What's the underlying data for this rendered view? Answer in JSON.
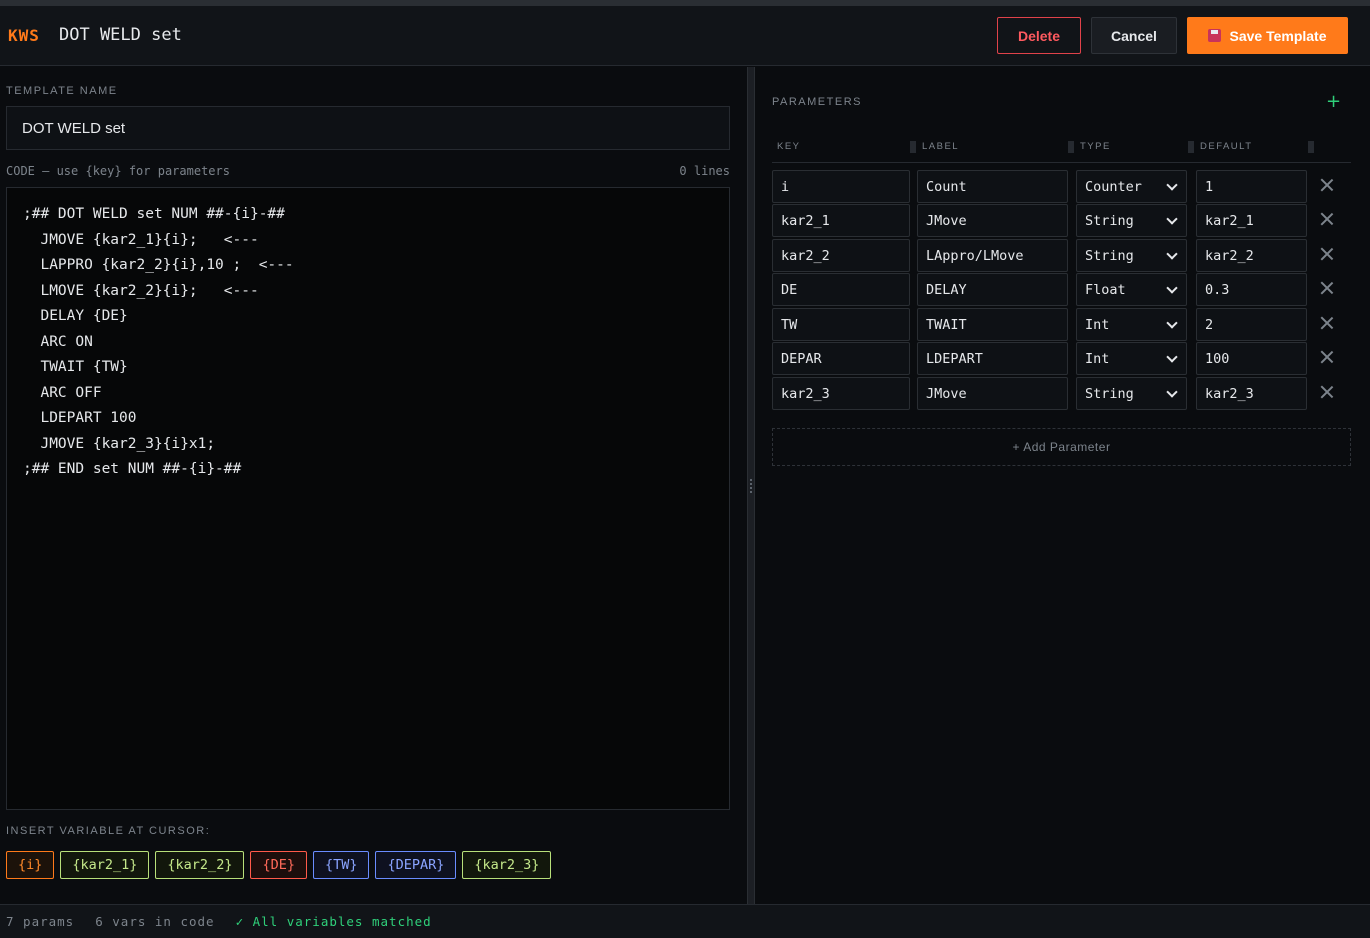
{
  "header": {
    "brand": "KWS",
    "title": "DOT WELD set",
    "delete_label": "Delete",
    "cancel_label": "Cancel",
    "save_label": "Save Template",
    "save_icon": "floppy-disk-icon"
  },
  "editor": {
    "template_name_label": "TEMPLATE NAME",
    "template_name_value": "DOT WELD set",
    "code_label": "CODE — use {key} for parameters",
    "lines_label": "0 lines",
    "code_lines": [
      ";## DOT WELD set NUM ##-{i}-##",
      "  JMOVE {kar2_1}{i};   <---",
      "  LAPPRO {kar2_2}{i},10 ;  <---",
      "  LMOVE {kar2_2}{i};   <---",
      "  DELAY {DE}",
      "  ARC ON",
      "  TWAIT {TW}",
      "  ARC OFF",
      "  LDEPART 100",
      "  JMOVE {kar2_3}{i}x1;",
      ";## END set NUM ##-{i}-##"
    ],
    "insert_label": "INSERT VARIABLE AT CURSOR:",
    "chips": [
      "{i}",
      "{kar2_1}",
      "{kar2_2}",
      "{DE}",
      "{TW}",
      "{DEPAR}",
      "{kar2_3}"
    ]
  },
  "params": {
    "title": "PARAMETERS",
    "add_icon": "plus-icon",
    "columns": [
      "KEY",
      "LABEL",
      "TYPE",
      "DEFAULT"
    ],
    "rows": [
      {
        "key": "i",
        "label": "Count",
        "type": "Counter",
        "default": "1"
      },
      {
        "key": "kar2_1",
        "label": "JMove",
        "type": "String",
        "default": "kar2_1"
      },
      {
        "key": "kar2_2",
        "label": "LAppro/LMove",
        "type": "String",
        "default": "kar2_2"
      },
      {
        "key": "DE",
        "label": "DELAY",
        "type": "Float",
        "default": "0.3"
      },
      {
        "key": "TW",
        "label": "TWAIT",
        "type": "Int",
        "default": "2"
      },
      {
        "key": "DEPAR",
        "label": "LDEPART",
        "type": "Int",
        "default": "100"
      },
      {
        "key": "kar2_3",
        "label": "JMove",
        "type": "String",
        "default": "kar2_3"
      }
    ],
    "add_parameter_label": "+ Add Parameter"
  },
  "status": {
    "params": "7 params",
    "vars": "6 vars in code",
    "match": "✓ All variables matched"
  },
  "colors": {
    "accent": "#ff7a1a",
    "danger": "#ff5a5f",
    "success": "#2fd07a"
  }
}
